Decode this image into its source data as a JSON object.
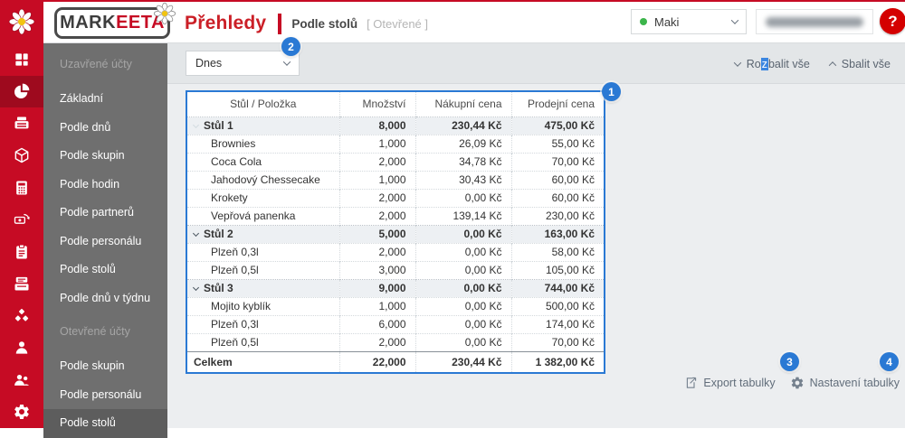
{
  "brand": {
    "logo_text_dark": "MARK",
    "logo_text_red": "EETA",
    "red": "#c60b24"
  },
  "header": {
    "title": "Přehledy",
    "breadcrumb": "Podle stolů",
    "breadcrumb_alt": "[ Otevřené ]",
    "account": {
      "name": "Maki",
      "status_dot_color": "#3cb54b"
    },
    "help_label": "?"
  },
  "sidebar": {
    "rail_icons": [
      "dashboard",
      "pie-chart",
      "printer",
      "package",
      "calculator",
      "money-transfer",
      "clipboard",
      "cash-register",
      "cubes",
      "person",
      "people",
      "gear"
    ],
    "selected_rail_icon": "pie-chart",
    "sections": [
      {
        "header": "Uzavřené účty",
        "items": [
          "Základní",
          "Podle dnů",
          "Podle skupin",
          "Podle hodin",
          "Podle partnerů",
          "Podle personálu",
          "Podle stolů",
          "Podle dnů v týdnu"
        ]
      },
      {
        "header": "Otevřené účty",
        "items": [
          "Podle skupin",
          "Podle personálu",
          "Podle stolů"
        ]
      }
    ],
    "selected_item": "Podle stolů"
  },
  "toolbar": {
    "date_filter_value": "Dnes",
    "expand_all": {
      "pre": "Ro",
      "highlighted": "z",
      "post": "balit vše"
    },
    "collapse_all": "Sbalit vše"
  },
  "table": {
    "columns": [
      "Stůl / Položka",
      "Množství",
      "Nákupní cena",
      "Prodejní cena"
    ],
    "rows": [
      {
        "type": "group",
        "label": "Stůl 1",
        "qty": "8,000",
        "purchase": "230,44 Kč",
        "sale": "475,00 Kč"
      },
      {
        "type": "item",
        "label": "Brownies",
        "qty": "1,000",
        "purchase": "26,09 Kč",
        "sale": "55,00 Kč"
      },
      {
        "type": "item",
        "label": "Coca Cola",
        "qty": "2,000",
        "purchase": "34,78 Kč",
        "sale": "70,00 Kč"
      },
      {
        "type": "item",
        "label": "Jahodový Chessecake",
        "qty": "1,000",
        "purchase": "30,43 Kč",
        "sale": "60,00 Kč"
      },
      {
        "type": "item",
        "label": "Krokety",
        "qty": "2,000",
        "purchase": "0,00 Kč",
        "sale": "60,00 Kč"
      },
      {
        "type": "item",
        "label": "Vepřová panenka",
        "qty": "2,000",
        "purchase": "139,14 Kč",
        "sale": "230,00 Kč"
      },
      {
        "type": "group",
        "label": "Stůl 2",
        "qty": "5,000",
        "purchase": "0,00 Kč",
        "sale": "163,00 Kč"
      },
      {
        "type": "item",
        "label": "Plzeň 0,3l",
        "qty": "2,000",
        "purchase": "0,00 Kč",
        "sale": "58,00 Kč"
      },
      {
        "type": "item",
        "label": "Plzeň 0,5l",
        "qty": "3,000",
        "purchase": "0,00 Kč",
        "sale": "105,00 Kč"
      },
      {
        "type": "group",
        "label": "Stůl 3",
        "qty": "9,000",
        "purchase": "0,00 Kč",
        "sale": "744,00 Kč"
      },
      {
        "type": "item",
        "label": "Mojito kyblík",
        "qty": "1,000",
        "purchase": "0,00 Kč",
        "sale": "500,00 Kč"
      },
      {
        "type": "item",
        "label": "Plzeň 0,3l",
        "qty": "6,000",
        "purchase": "0,00 Kč",
        "sale": "174,00 Kč"
      },
      {
        "type": "item",
        "label": "Plzeň 0,5l",
        "qty": "2,000",
        "purchase": "0,00 Kč",
        "sale": "70,00 Kč"
      }
    ],
    "total": {
      "label": "Celkem",
      "qty": "22,000",
      "purchase": "230,44 Kč",
      "sale": "1 382,00 Kč"
    }
  },
  "footer": {
    "export_label": "Export tabulky",
    "settings_label": "Nastavení tabulky"
  },
  "annotations": {
    "color": "#2a79d4",
    "badges": [
      "1",
      "2",
      "3",
      "4"
    ]
  }
}
